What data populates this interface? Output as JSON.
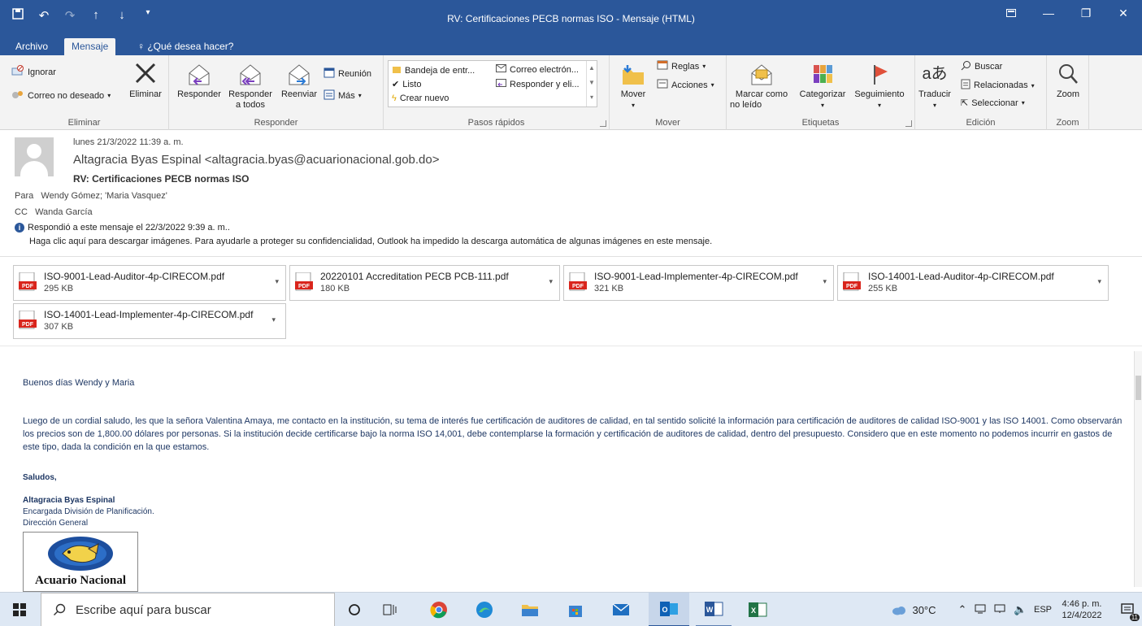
{
  "window": {
    "title": "RV: Certificaciones PECB normas ISO  -  Mensaje (HTML)"
  },
  "tabs": {
    "archivo": "Archivo",
    "mensaje": "Mensaje",
    "tell_me": "¿Qué desea hacer?"
  },
  "ribbon": {
    "eliminar": {
      "ignorar": "Ignorar",
      "correo_no_deseado": "Correo no deseado",
      "eliminar": "Eliminar",
      "group": "Eliminar"
    },
    "responder": {
      "responder": "Responder",
      "responder_todos_1": "Responder",
      "responder_todos_2": "a todos",
      "reenviar": "Reenviar",
      "reunion": "Reunión",
      "mas": "Más",
      "group": "Responder"
    },
    "pasos_rapidos": {
      "items": [
        "Bandeja de entr...",
        "Listo",
        "Crear nuevo",
        "Correo electrón...",
        "Responder y eli..."
      ],
      "group": "Pasos rápidos"
    },
    "mover": {
      "mover": "Mover",
      "reglas": "Reglas",
      "acciones": "Acciones",
      "group": "Mover"
    },
    "etiquetas": {
      "marcar_1": "Marcar como",
      "marcar_2": "no leído",
      "categorizar": "Categorizar",
      "seguimiento": "Seguimiento",
      "group": "Etiquetas"
    },
    "edicion": {
      "traducir": "Traducir",
      "buscar": "Buscar",
      "relacionadas": "Relacionadas",
      "seleccionar": "Seleccionar",
      "group": "Edición"
    },
    "zoom": {
      "zoom": "Zoom",
      "group": "Zoom"
    }
  },
  "message": {
    "date": "lunes 21/3/2022 11:39 a. m.",
    "from": "Altagracia Byas Espinal <altagracia.byas@acuarionacional.gob.do>",
    "subject": "RV: Certificaciones PECB normas ISO",
    "to_label": "Para",
    "to": "Wendy Gómez; 'Maria Vasquez'",
    "cc_label": "CC",
    "cc": "Wanda García",
    "info_replied": "Respondió a este mensaje el 22/3/2022 9:39 a. m..",
    "info_images": "Haga clic aquí para descargar imágenes. Para ayudarle a proteger su confidencialidad, Outlook ha impedido la descarga automática de algunas imágenes en este mensaje."
  },
  "attachments": [
    {
      "name": "ISO-9001-Lead-Auditor-4p-CIRECOM.pdf",
      "size": "295 KB"
    },
    {
      "name": "20220101 Accreditation PECB PCB-111.pdf",
      "size": "180 KB"
    },
    {
      "name": "ISO-9001-Lead-Implementer-4p-CIRECOM.pdf",
      "size": "321 KB"
    },
    {
      "name": "ISO-14001-Lead-Auditor-4p-CIRECOM.pdf",
      "size": "255 KB"
    },
    {
      "name": "ISO-14001-Lead-Implementer-4p-CIRECOM.pdf",
      "size": "307 KB"
    }
  ],
  "body": {
    "greeting": "Buenos días Wendy y Maria",
    "paragraph": "Luego de un cordial saludo, les que la señora Valentina Amaya, me contacto en la institución, su tema de interés fue certificación de auditores de calidad, en tal sentido solicité la información para certificación de auditores de calidad ISO-9001 y las ISO 14001.  Como observarán los precios son de 1,800.00 dólares por personas.  Si la institución decide certificarse bajo la norma ISO 14,001, debe contemplarse la formación y certificación de auditores de calidad, dentro del presupuesto.  Considero que en este momento no podemos incurrir en gastos de este tipo, dada la condición en la que estamos.",
    "closing": "Saludos,",
    "sig_name": "Altagracia Byas Espinal",
    "sig_title": "Encargada División de Planificación.",
    "sig_dept": "Dirección General",
    "logo_text": "Acuario Nacional"
  },
  "taskbar": {
    "search_placeholder": "Escribe aquí para buscar",
    "weather": "30°C",
    "lang": "ESP",
    "time": "4:46 p. m.",
    "date": "12/4/2022",
    "notif_count": "11"
  },
  "colors": {
    "accent": "#2b579a",
    "ribbon_bg": "#f3f3f3",
    "body_text": "#1f3864",
    "pdf_red": "#d9251c"
  }
}
